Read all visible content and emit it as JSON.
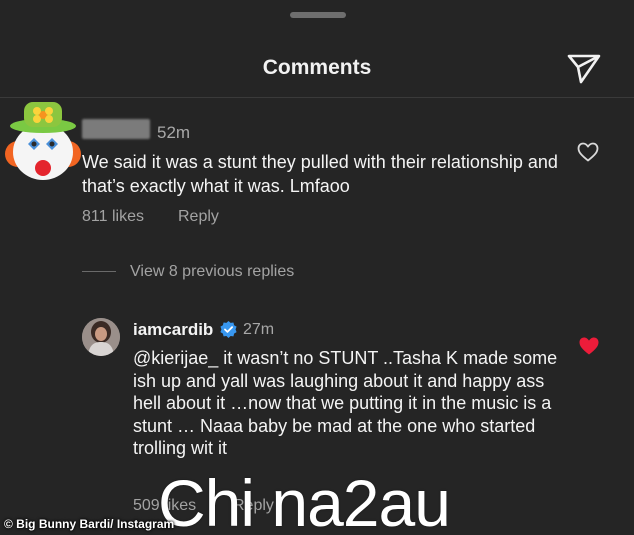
{
  "header": {
    "title": "Comments",
    "send_icon": "paper-plane-icon"
  },
  "comment": {
    "username_redacted": true,
    "time": "52m",
    "text": "We said it was a stunt they pulled with their relationship and that’s exactly what it was. Lmfaoo",
    "likes": "811 likes",
    "reply": "Reply",
    "avatar": "clown-emoji-avatar",
    "liked": false
  },
  "thread": {
    "view_replies": "View 8 previous replies"
  },
  "reply_comment": {
    "username": "iamcardib",
    "verified": true,
    "time": "27m",
    "text": "@kierijae_ it wasn’t no STUNT ..Tasha K made some ish up and yall was laughing about it and happy ass hell about it …now that we putting it in the music is a stunt … Naaa baby be mad at the one who started trolling wit it",
    "likes": "509 likes",
    "reply": "Reply",
    "liked": true
  },
  "overlay": {
    "watermark": "Chi na2au",
    "credit": "© Big Bunny Bardi/ Instagram"
  },
  "colors": {
    "background": "#252525",
    "text": "#f4f4f4",
    "muted": "#a3a3a3",
    "like_red": "#ed1c3a",
    "verified_blue": "#3897f0"
  }
}
